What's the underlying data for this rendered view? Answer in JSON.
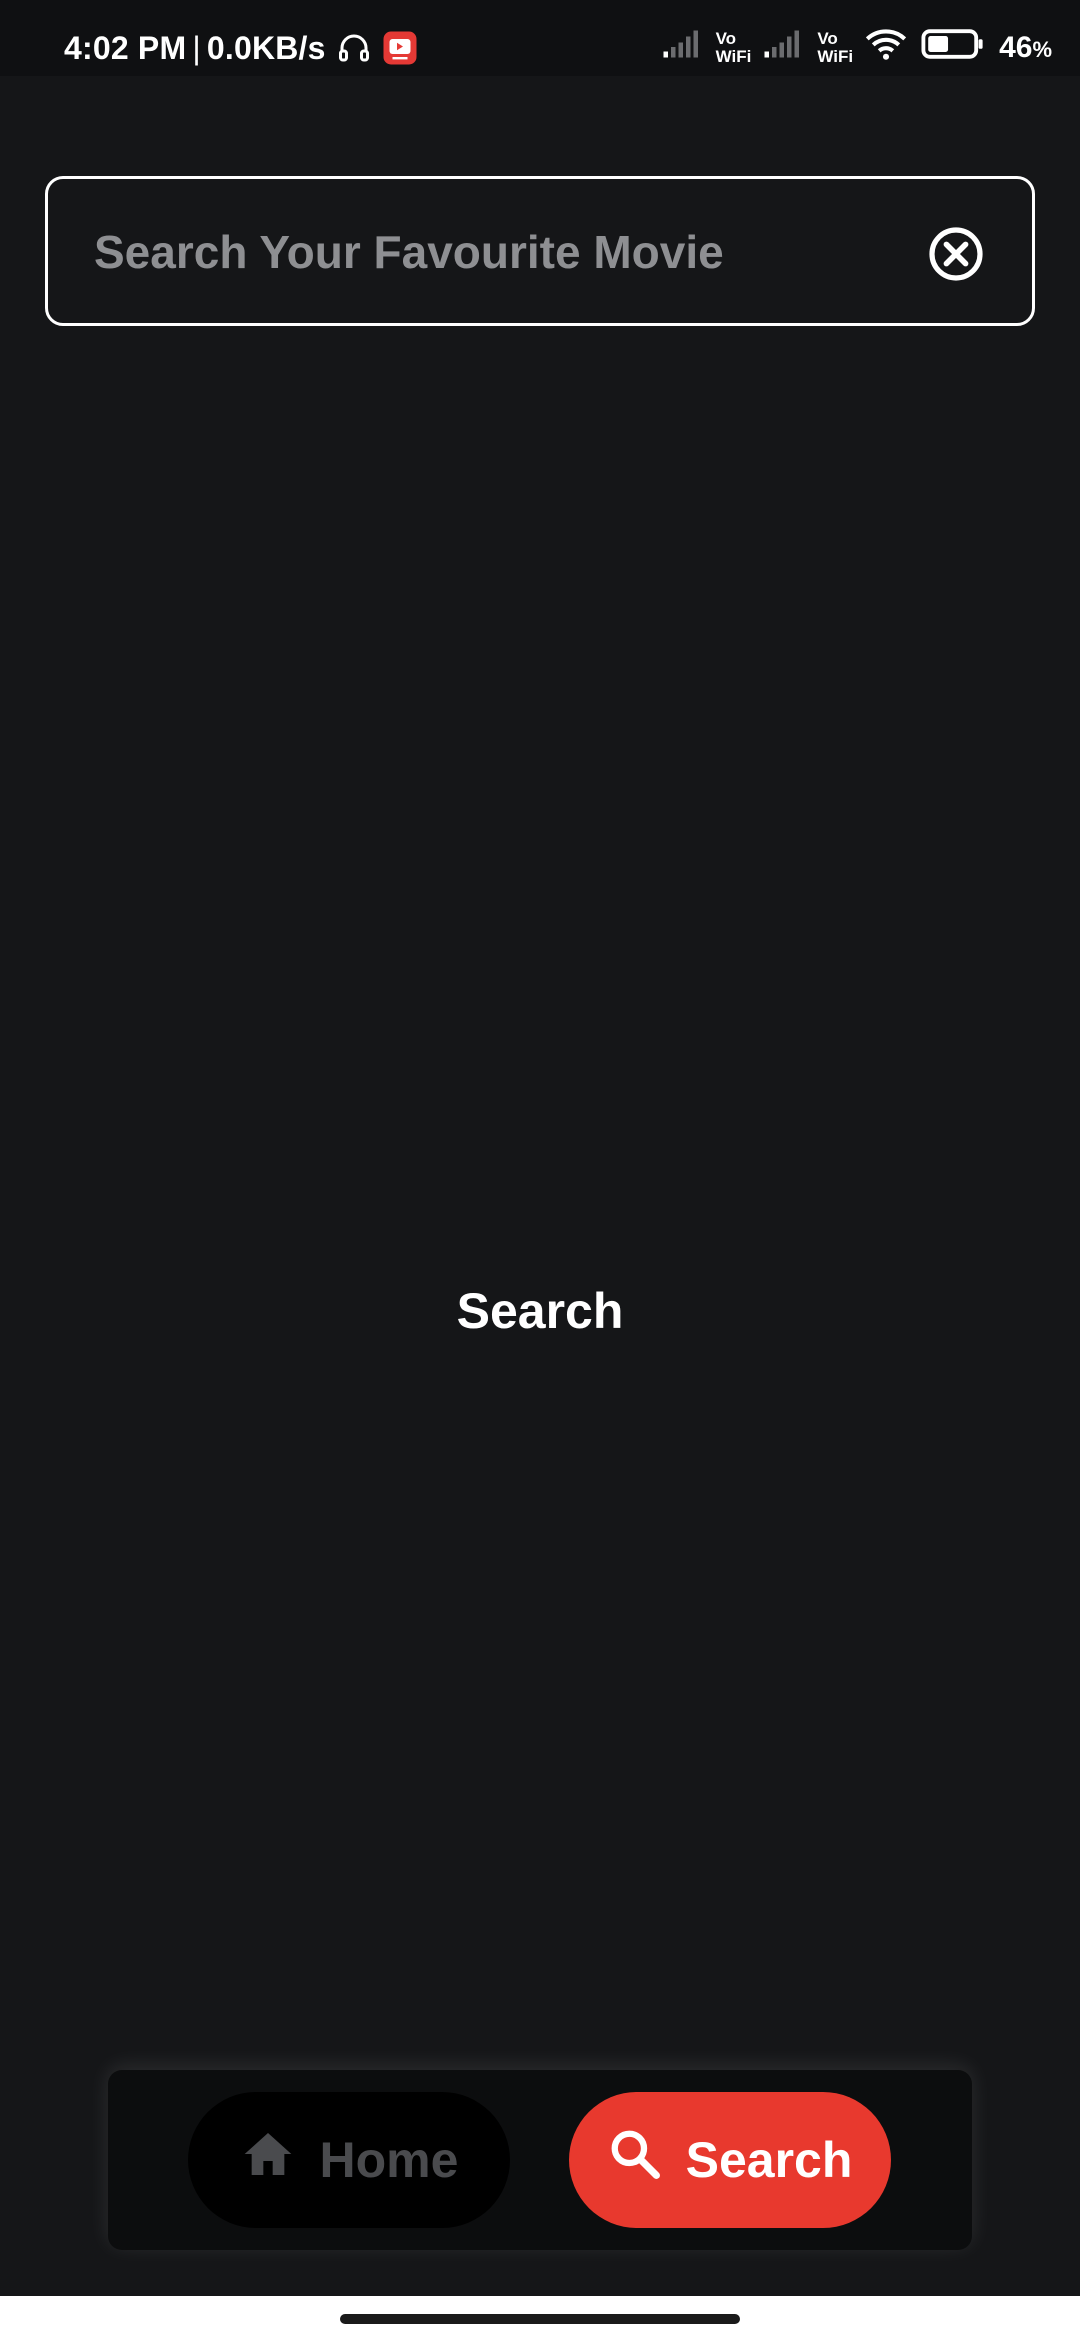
{
  "status_bar": {
    "time": "4:02 PM",
    "separator": "|",
    "network_speed": "0.0KB/s",
    "vowifi_1_top": "Vo",
    "vowifi_1_bottom": "WiFi",
    "vowifi_2_top": "Vo",
    "vowifi_2_bottom": "WiFi",
    "battery_value": "46",
    "battery_unit": "%",
    "battery_level": 0.46,
    "icons": [
      "headphones-icon",
      "youtube-icon",
      "signal-icon",
      "signal-icon",
      "wifi-icon",
      "battery-icon"
    ]
  },
  "search": {
    "placeholder": "Search Your Favourite Movie",
    "value": "",
    "clear_icon": "close-circle-icon"
  },
  "main": {
    "center_text": "Search"
  },
  "bottom_nav": {
    "items": [
      {
        "label": "Home",
        "icon": "home-icon",
        "active": false
      },
      {
        "label": "Search",
        "icon": "search-icon",
        "active": true
      }
    ]
  },
  "colors": {
    "background": "#151618",
    "accent": "#e8392e",
    "inactive": "#4a4b4e",
    "text": "#ffffff"
  }
}
